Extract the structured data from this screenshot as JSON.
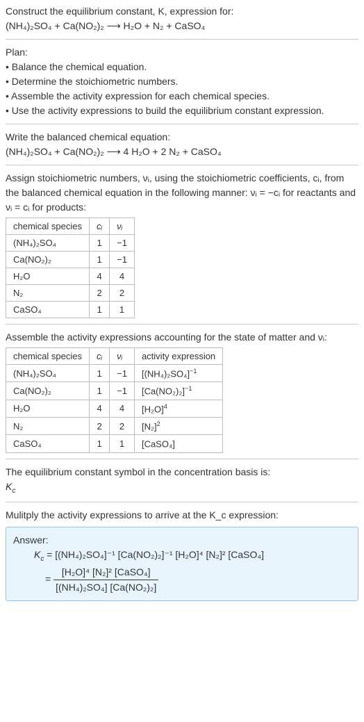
{
  "intro": {
    "l1": "Construct the equilibrium constant, K, expression for:",
    "eq_unbalanced": "(NH₄)₂SO₄ + Ca(NO₂)₂ ⟶ H₂O + N₂ + CaSO₄"
  },
  "plan": {
    "h": "Plan:",
    "b1": "• Balance the chemical equation.",
    "b2": "• Determine the stoichiometric numbers.",
    "b3": "• Assemble the activity expression for each chemical species.",
    "b4": "• Use the activity expressions to build the equilibrium constant expression."
  },
  "balanced": {
    "h": "Write the balanced chemical equation:",
    "eq": "(NH₄)₂SO₄ + Ca(NO₂)₂ ⟶ 4 H₂O + 2 N₂ + CaSO₄"
  },
  "assign": {
    "t": "Assign stoichiometric numbers, νᵢ, using the stoichiometric coefficients, cᵢ, from the balanced chemical equation in the following manner: νᵢ = −cᵢ for reactants and νᵢ = cᵢ for products:"
  },
  "table1": {
    "h1": "chemical species",
    "h2": "cᵢ",
    "h3": "νᵢ",
    "rows": [
      {
        "sp": "(NH₄)₂SO₄",
        "c": "1",
        "v": "−1"
      },
      {
        "sp": "Ca(NO₂)₂",
        "c": "1",
        "v": "−1"
      },
      {
        "sp": "H₂O",
        "c": "4",
        "v": "4"
      },
      {
        "sp": "N₂",
        "c": "2",
        "v": "2"
      },
      {
        "sp": "CaSO₄",
        "c": "1",
        "v": "1"
      }
    ]
  },
  "assemble": {
    "t": "Assemble the activity expressions accounting for the state of matter and νᵢ:"
  },
  "table2": {
    "h1": "chemical species",
    "h2": "cᵢ",
    "h3": "νᵢ",
    "h4": "activity expression",
    "rows": [
      {
        "sp": "(NH₄)₂SO₄",
        "c": "1",
        "v": "−1",
        "a_base": "[(NH₄)₂SO₄]",
        "a_exp": "−1"
      },
      {
        "sp": "Ca(NO₂)₂",
        "c": "1",
        "v": "−1",
        "a_base": "[Ca(NO₂)₂]",
        "a_exp": "−1"
      },
      {
        "sp": "H₂O",
        "c": "4",
        "v": "4",
        "a_base": "[H₂O]",
        "a_exp": "4"
      },
      {
        "sp": "N₂",
        "c": "2",
        "v": "2",
        "a_base": "[N₂]",
        "a_exp": "2"
      },
      {
        "sp": "CaSO₄",
        "c": "1",
        "v": "1",
        "a_base": "[CaSO₄]",
        "a_exp": ""
      }
    ]
  },
  "eqconst": {
    "l1": "The equilibrium constant symbol in the concentration basis is:",
    "sym": "K_c"
  },
  "multiply": {
    "t": "Mulitply the activity expressions to arrive at the K_c expression:"
  },
  "answer": {
    "label": "Answer:",
    "line1_lhs": "K_c = ",
    "line1_rhs": "[(NH₄)₂SO₄]⁻¹ [Ca(NO₂)₂]⁻¹ [H₂O]⁴ [N₂]² [CaSO₄]",
    "frac_num": "[H₂O]⁴ [N₂]² [CaSO₄]",
    "frac_den": "[(NH₄)₂SO₄] [Ca(NO₂)₂]",
    "eq_sign": "= "
  }
}
